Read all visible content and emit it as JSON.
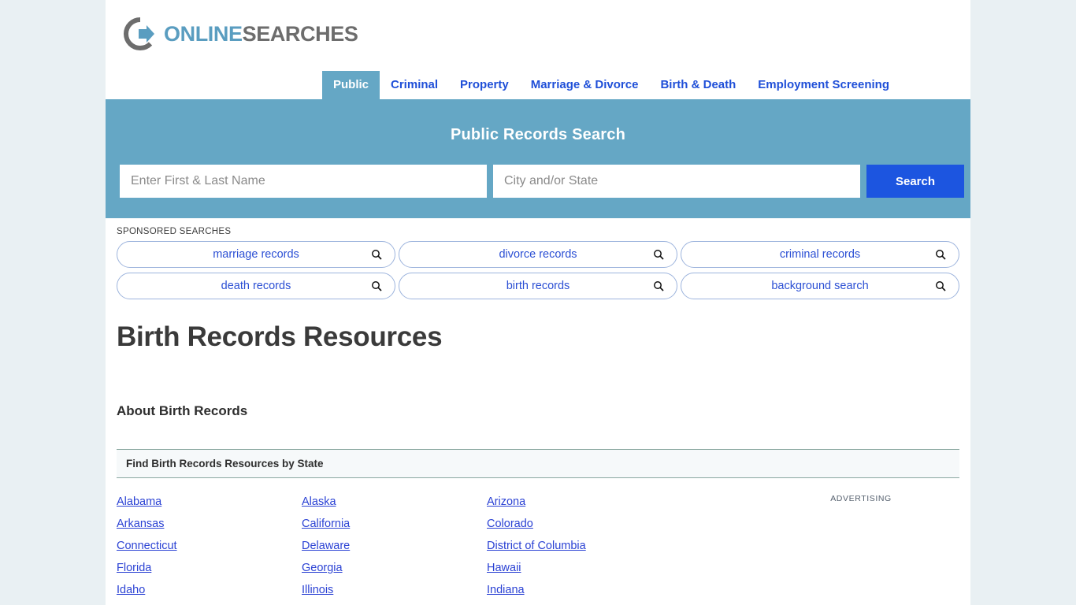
{
  "brand": {
    "logo_icon": "circle-arrow-logo-icon",
    "name_part1": "ONLINE",
    "name_part2": "SEARCHES",
    "color_part1": "#5a9dc0",
    "color_part2": "#6d6d6d"
  },
  "nav": {
    "items": [
      {
        "label": "Public",
        "active": true
      },
      {
        "label": "Criminal",
        "active": false
      },
      {
        "label": "Property",
        "active": false
      },
      {
        "label": "Marriage & Divorce",
        "active": false
      },
      {
        "label": "Birth & Death",
        "active": false
      },
      {
        "label": "Employment Screening",
        "active": false
      }
    ],
    "active_bg": "#65a7c5",
    "link_color": "#1f4fd8"
  },
  "search": {
    "title": "Public Records Search",
    "band_color": "#65a7c5",
    "name_value": "",
    "name_placeholder": "Enter First & Last Name",
    "city_value": "",
    "city_placeholder": "City and/or State",
    "button_label": "Search",
    "button_color": "#1c55e0"
  },
  "sponsored": {
    "label": "SPONSORED SEARCHES",
    "icon": "search-icon",
    "items": [
      {
        "label": "marriage records"
      },
      {
        "label": "divorce records"
      },
      {
        "label": "criminal records"
      },
      {
        "label": "death records"
      },
      {
        "label": "birth records"
      },
      {
        "label": "background search"
      }
    ]
  },
  "main": {
    "page_title": "Birth Records Resources",
    "section_title": "About Birth Records"
  },
  "states": {
    "header": "Find Birth Records Resources by State",
    "links": [
      "Alabama",
      "Alaska",
      "Arizona",
      "Arkansas",
      "California",
      "Colorado",
      "Connecticut",
      "Delaware",
      "District of Columbia",
      "Florida",
      "Georgia",
      "Hawaii",
      "Idaho",
      "Illinois",
      "Indiana"
    ]
  },
  "advertising": {
    "label": "ADVERTISING"
  }
}
